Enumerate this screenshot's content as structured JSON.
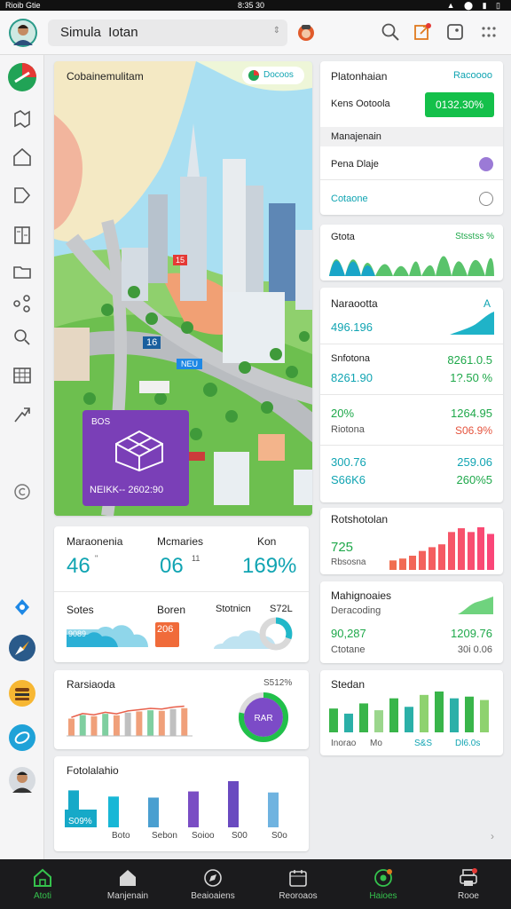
{
  "status": {
    "left": "Rioib Gtie",
    "time": "8:35 30"
  },
  "search": {
    "value": "Simula  Iotan"
  },
  "map": {
    "title": "Cobainemulitam",
    "badge": "Docoos",
    "overlay_tag": "BOS",
    "overlay_caption": "NEIKK-- 2602:90",
    "labels": [
      "16",
      "NEU",
      "15"
    ]
  },
  "right_panel": {
    "title": "Platonhaian",
    "link": "Racoooo",
    "row_label": "Kens Ootoola",
    "row_value": "0132.30%",
    "section": "Manajenain",
    "option_1": "Pena Dlaje",
    "option_2": "Cotaone"
  },
  "card_strip": {
    "title": "Gtota",
    "value": "Stsstss %"
  },
  "stats_card": {
    "title": "Naraootta",
    "peak": "A",
    "value1": "496.196",
    "r2_label": "Snfotona",
    "r2_value": "8261.0.5",
    "r2_sub_left": "8261.90",
    "r2_sub_right": "1?.50 %",
    "r3_left": "20%",
    "r3_right": "1264.95",
    "r3_sub_left": "Riotona",
    "r3_sub_right": "S06.9%",
    "r4_left": "300.76",
    "r4_right": "259.06",
    "r4_sub_left": "S66K6",
    "r4_sub_right": "260%5"
  },
  "kpi": {
    "c1_label": "Maraonenia",
    "c1_value": "46",
    "c1_sup": "\"",
    "c2_label": "Mcmaries",
    "c2_value": "06",
    "c2_sup": "11",
    "c3_label": "Kon",
    "c3_value": "169%",
    "b1_label": "Sotes",
    "b1_chip": "9089",
    "b2_label": "Boren",
    "b2_chip": "206",
    "b3_label": "Stotnicn",
    "b3_value": "S72L"
  },
  "bars_card": {
    "title": "Rotshotolan",
    "value": "725",
    "label": "Rbsosna",
    "values": [
      10,
      12,
      15,
      20,
      24,
      27,
      40,
      44,
      40,
      45,
      38
    ]
  },
  "line_card": {
    "title": "Rarsiaoda",
    "pct": "S512%",
    "donut_label": "RAR",
    "donut_pct": 78
  },
  "mini_card": {
    "title": "Mahignoaies",
    "sub": "Deracoding",
    "left": "90,287",
    "right": "1209.76",
    "sub_left": "Ctotane",
    "sub_right": "30i 0.06"
  },
  "green_bars": {
    "title": "Stedan",
    "values": [
      28,
      22,
      34,
      26,
      40,
      30,
      44,
      48,
      40,
      42,
      38
    ],
    "label_1": "Inorao",
    "label_2": "Mo",
    "label_3": "S&S",
    "label_4": "Dl6.0s"
  },
  "bottom_card": {
    "title": "Fotolalahio",
    "labels": [
      "S09%",
      "Boto",
      "Sebon",
      "Soioo",
      "S00",
      "S0o"
    ],
    "values": [
      72,
      60,
      58,
      70,
      90,
      68
    ]
  },
  "line_values": [
    0.58,
    0.7,
    0.66,
    0.74,
    0.69,
    0.78,
    0.82,
    0.86,
    0.84,
    0.9,
    0.93
  ],
  "bottom_nav": [
    "Atoti",
    "Manjenain",
    "Beaioaiens",
    "Reoroaos",
    "Haioes",
    "Rooe"
  ]
}
